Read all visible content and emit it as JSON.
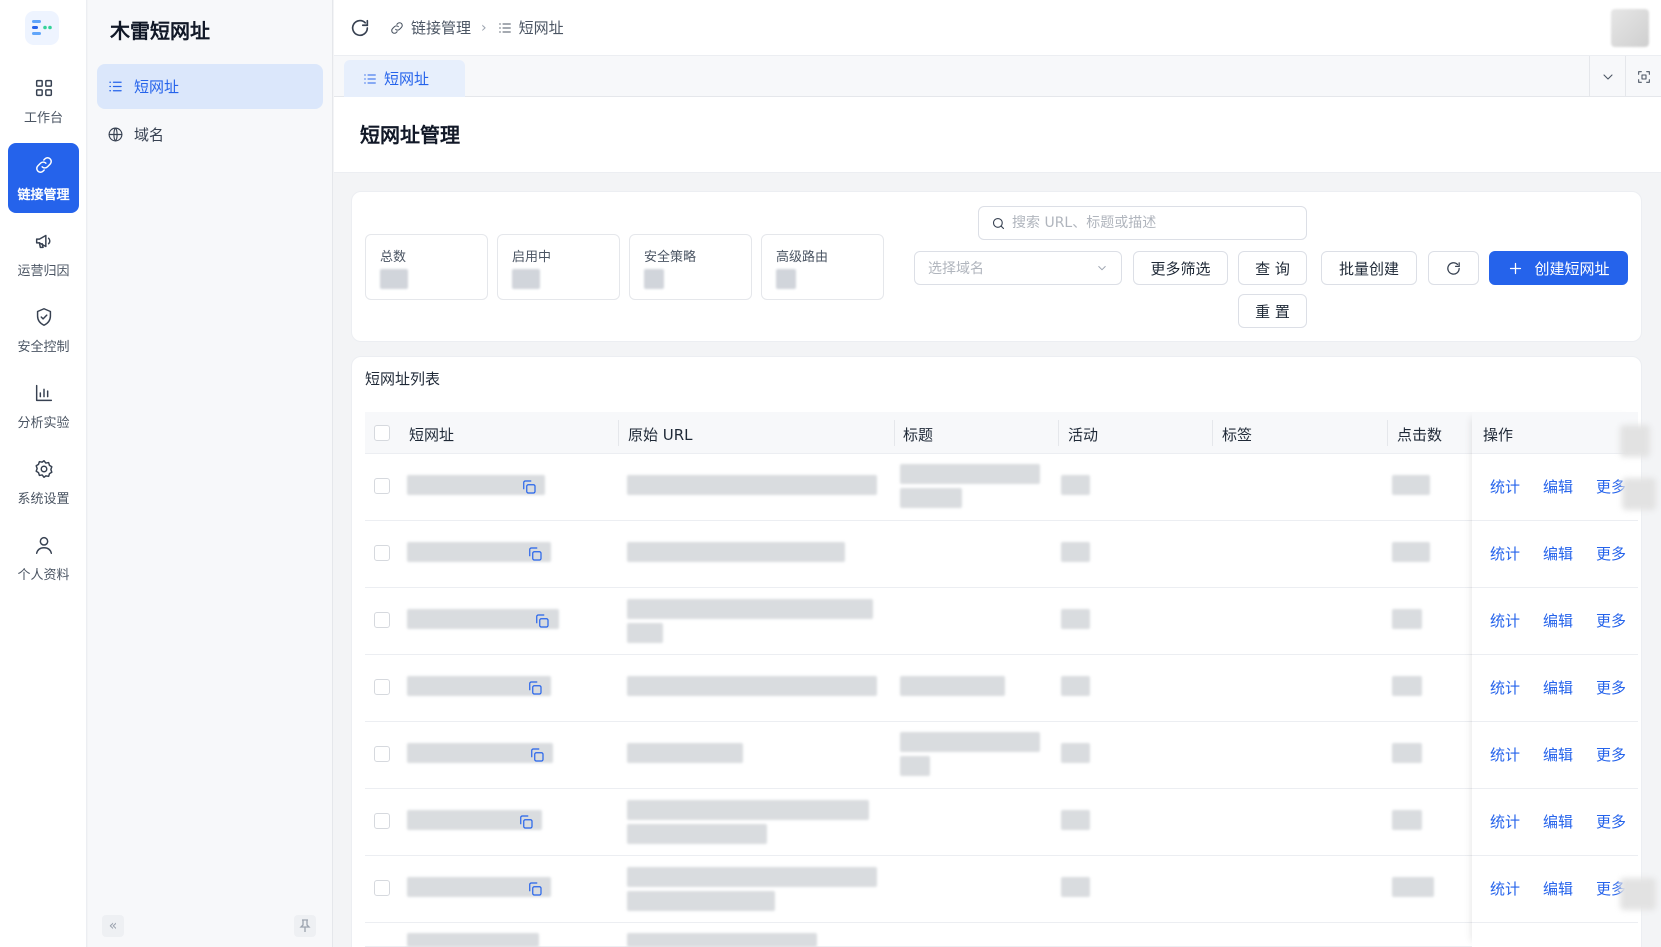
{
  "app": {
    "title": "木雷短网址"
  },
  "rail": [
    {
      "label": "工作台",
      "icon": "dashboard-icon"
    },
    {
      "label": "链接管理",
      "icon": "link-icon",
      "active": true
    },
    {
      "label": "运营归因",
      "icon": "megaphone-icon"
    },
    {
      "label": "安全控制",
      "icon": "shield-icon"
    },
    {
      "label": "分析实验",
      "icon": "bar-chart-icon"
    },
    {
      "label": "系统设置",
      "icon": "gear-icon"
    },
    {
      "label": "个人资料",
      "icon": "user-icon"
    }
  ],
  "sidebar": {
    "items": [
      {
        "label": "短网址",
        "icon": "list-icon",
        "active": true
      },
      {
        "label": "域名",
        "icon": "globe-icon"
      }
    ]
  },
  "breadcrumb": {
    "parent": "链接管理",
    "current": "短网址"
  },
  "tabs": [
    {
      "label": "短网址"
    }
  ],
  "page": {
    "title": "短网址管理"
  },
  "stats": [
    {
      "label": "总数"
    },
    {
      "label": "启用中"
    },
    {
      "label": "安全策略"
    },
    {
      "label": "高级路由"
    }
  ],
  "filters": {
    "search_placeholder": "搜索 URL、标题或描述",
    "domain_placeholder": "选择域名",
    "more_filters": "更多筛选",
    "query": "查 询",
    "reset": "重 置",
    "batch_create": "批量创建",
    "create": "创建短网址"
  },
  "table": {
    "title": "短网址列表",
    "columns": [
      "短网址",
      "原始 URL",
      "标题",
      "活动",
      "标签",
      "点击数",
      "操作"
    ],
    "actions": [
      "统计",
      "编辑",
      "更多"
    ]
  }
}
